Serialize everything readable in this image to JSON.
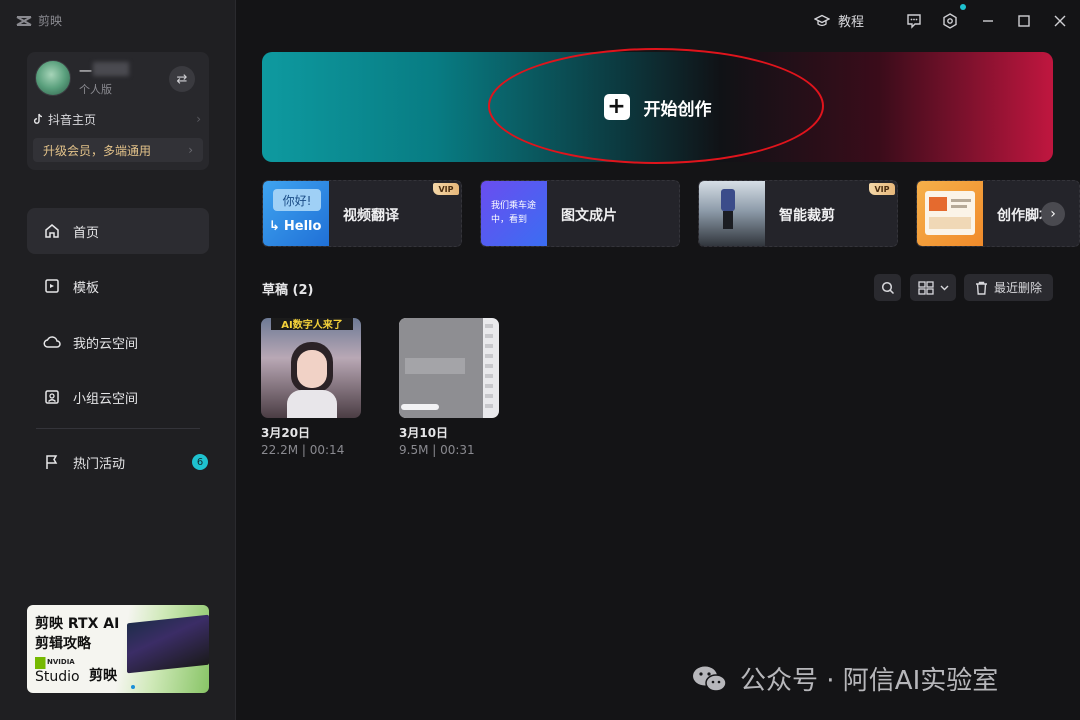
{
  "app": {
    "name": "剪映"
  },
  "titlebar": {
    "tutorial_label": "教程"
  },
  "profile": {
    "name": "一",
    "level": "个人版",
    "douyin_label": "抖音主页",
    "vip_label": "升级会员，多端通用"
  },
  "nav": {
    "items": [
      {
        "label": "首页",
        "icon": "home-icon",
        "active": true
      },
      {
        "label": "模板",
        "icon": "template-icon"
      },
      {
        "label": "我的云空间",
        "icon": "cloud-icon"
      },
      {
        "label": "小组云空间",
        "icon": "group-cloud-icon"
      },
      {
        "label": "热门活动",
        "icon": "flag-icon",
        "badge": "6"
      }
    ]
  },
  "promo": {
    "line1": "剪映 RTX AI",
    "line2": "剪辑攻略",
    "nvidia": "NVIDIA",
    "studio": "Studio",
    "brand": "剪映"
  },
  "hero": {
    "label": "开始创作"
  },
  "features": [
    {
      "label": "视频翻译",
      "vip": "VIP",
      "thumb_text1": "你好!",
      "thumb_text2": "Hello"
    },
    {
      "label": "图文成片",
      "thumb_text1": "我们乘车途",
      "thumb_text2": "中，看到"
    },
    {
      "label": "智能裁剪",
      "vip": "VIP"
    },
    {
      "label": "创作脚本"
    }
  ],
  "drafts": {
    "title": "草稿 (2)",
    "recent_delete_label": "最近删除",
    "items": [
      {
        "date": "3月20日",
        "meta": "22.2M | 00:14",
        "caption": "AI数字人来了"
      },
      {
        "date": "3月10日",
        "meta": "9.5M | 00:31"
      }
    ]
  },
  "watermark": {
    "text": "公众号 · 阿信AI实验室"
  },
  "colors": {
    "accent": "#1ec2cf",
    "hero_left": "#0e9aa0",
    "hero_right": "#c0163f",
    "highlight_ring": "#e0141c"
  }
}
